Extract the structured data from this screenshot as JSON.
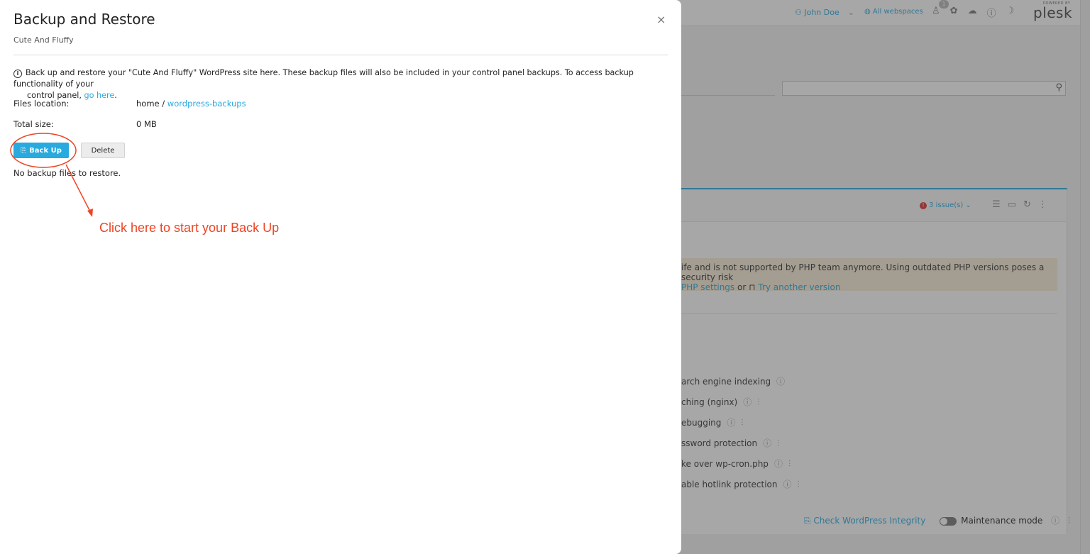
{
  "modal": {
    "title": "Backup and Restore",
    "subtitle": "Cute And Fluffy",
    "close_icon": "×",
    "info_text": "Back up and restore your \"Cute And Fluffy\" WordPress site here. These backup files will also be included in your control panel backups. To access backup functionality of your",
    "info_text_2": "control panel,",
    "info_link": "go here",
    "info_end": ".",
    "files_location_label": "Files location:",
    "files_location_prefix": "home /",
    "files_location_link": "wordpress-backups",
    "total_size_label": "Total size:",
    "total_size_value": "0 MB",
    "backup_button": "Back Up",
    "delete_button": "Delete",
    "no_backups": "No backup files to restore."
  },
  "annotation": {
    "text": "Click here to start your Back Up",
    "color": "#ee4422"
  },
  "background": {
    "user_name": "John Doe",
    "webspaces": "All webspaces",
    "notification_count": "1",
    "logo": "plesk",
    "logo_small": "POWERED BY",
    "issues": "3 issue(s)",
    "warning_line1": "ife and is not supported by PHP team anymore. Using outdated PHP versions poses a security risk",
    "warning_link1": "PHP settings",
    "warning_or": "or",
    "warning_link2": "Try another version",
    "tools": [
      "arch engine indexing",
      "ching (nginx)",
      "ebugging",
      "ssword protection",
      "ke over wp-cron.php",
      "able hotlink protection"
    ],
    "check_integrity": "Check WordPress Integrity",
    "maintenance_mode": "Maintenance mode"
  },
  "colors": {
    "accent": "#28aade",
    "annotation": "#ee4422"
  }
}
